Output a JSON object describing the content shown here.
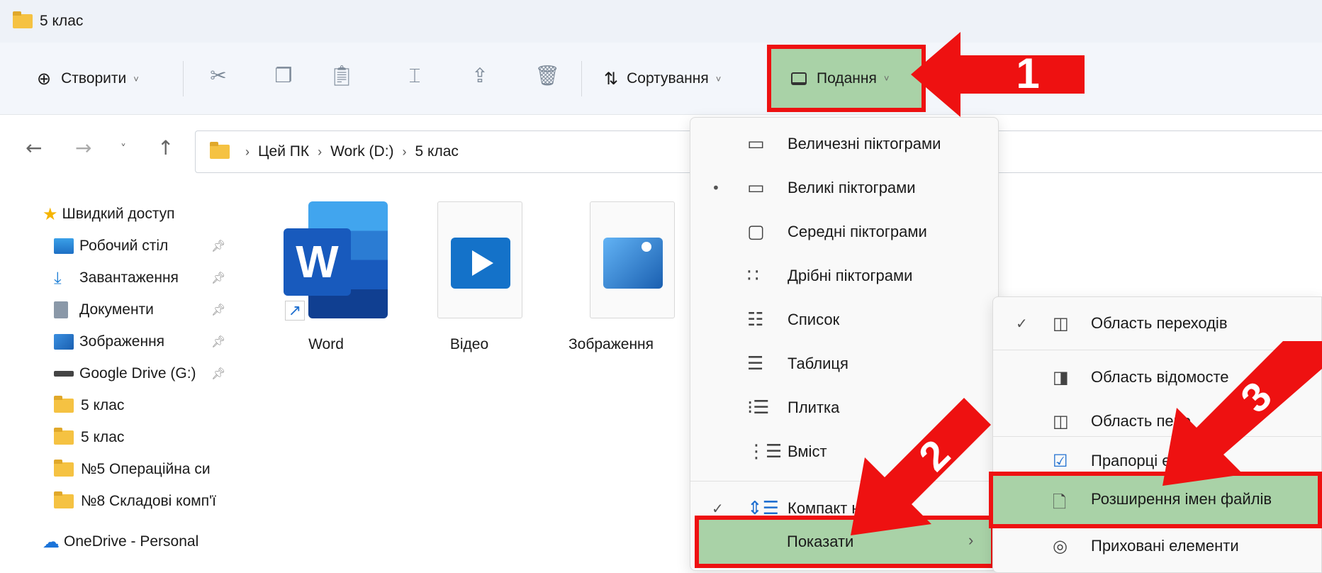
{
  "window": {
    "title": "5 клас"
  },
  "toolbar": {
    "create_label": "Створити",
    "sort_label": "Сортування",
    "view_label": "Подання"
  },
  "nav": {
    "breadcrumb": [
      "Цей ПК",
      "Work (D:)",
      "5 клас"
    ]
  },
  "sidebar": {
    "quick_access": "Швидкий доступ",
    "items": [
      {
        "label": "Робочий стіл",
        "pinned": true
      },
      {
        "label": "Завантаження",
        "pinned": true
      },
      {
        "label": "Документи",
        "pinned": true
      },
      {
        "label": "Зображення",
        "pinned": true
      },
      {
        "label": "Google Drive (G:)",
        "pinned": true
      },
      {
        "label": "5 клас",
        "pinned": false
      },
      {
        "label": "5 клас",
        "pinned": false
      },
      {
        "label": "№5 Операційна си",
        "pinned": false
      },
      {
        "label": "№8 Складові комп'ї",
        "pinned": false
      }
    ],
    "onedrive": "OneDrive - Personal"
  },
  "files": [
    {
      "name": "Word",
      "icon": "word-icon"
    },
    {
      "name": "Відео",
      "icon": "video-icon"
    },
    {
      "name": "Зображення",
      "icon": "image-icon"
    }
  ],
  "view_menu": {
    "items": [
      {
        "label": "Величезні піктограми",
        "icon": "extra-large-icons-icon",
        "mark": ""
      },
      {
        "label": "Великі піктограми",
        "icon": "large-icons-icon",
        "mark": "•"
      },
      {
        "label": "Середні піктограми",
        "icon": "medium-icons-icon",
        "mark": ""
      },
      {
        "label": "Дрібні піктограми",
        "icon": "small-icons-icon",
        "mark": ""
      },
      {
        "label": "Список",
        "icon": "list-icon",
        "mark": ""
      },
      {
        "label": "Таблиця",
        "icon": "details-icon",
        "mark": ""
      },
      {
        "label": "Плитка",
        "icon": "tiles-icon",
        "mark": ""
      },
      {
        "label": "Вміст",
        "icon": "content-icon",
        "mark": ""
      },
      {
        "label": "Компакт ння",
        "icon": "compact-view-icon",
        "mark": "✓"
      }
    ],
    "show_label": "Показати"
  },
  "show_submenu": {
    "items": [
      {
        "label": "Область переходів",
        "icon": "navigation-pane-icon",
        "mark": "✓"
      },
      {
        "label": "Область відомосте",
        "icon": "details-pane-icon",
        "mark": ""
      },
      {
        "label": "Область пере",
        "icon": "preview-pane-icon",
        "mark": ""
      },
      {
        "label": "Прапорці ентів",
        "icon": "item-checkboxes-icon",
        "mark": ""
      },
      {
        "label": "Розширення імен файлів",
        "icon": "file-extensions-icon",
        "mark": ""
      },
      {
        "label": "Приховані елементи",
        "icon": "hidden-items-icon",
        "mark": ""
      }
    ]
  },
  "annotations": {
    "step1": "1",
    "step2": "2",
    "step3": "3",
    "highlight_color": "#a9d2a7",
    "arrow_color": "#ee1111"
  }
}
